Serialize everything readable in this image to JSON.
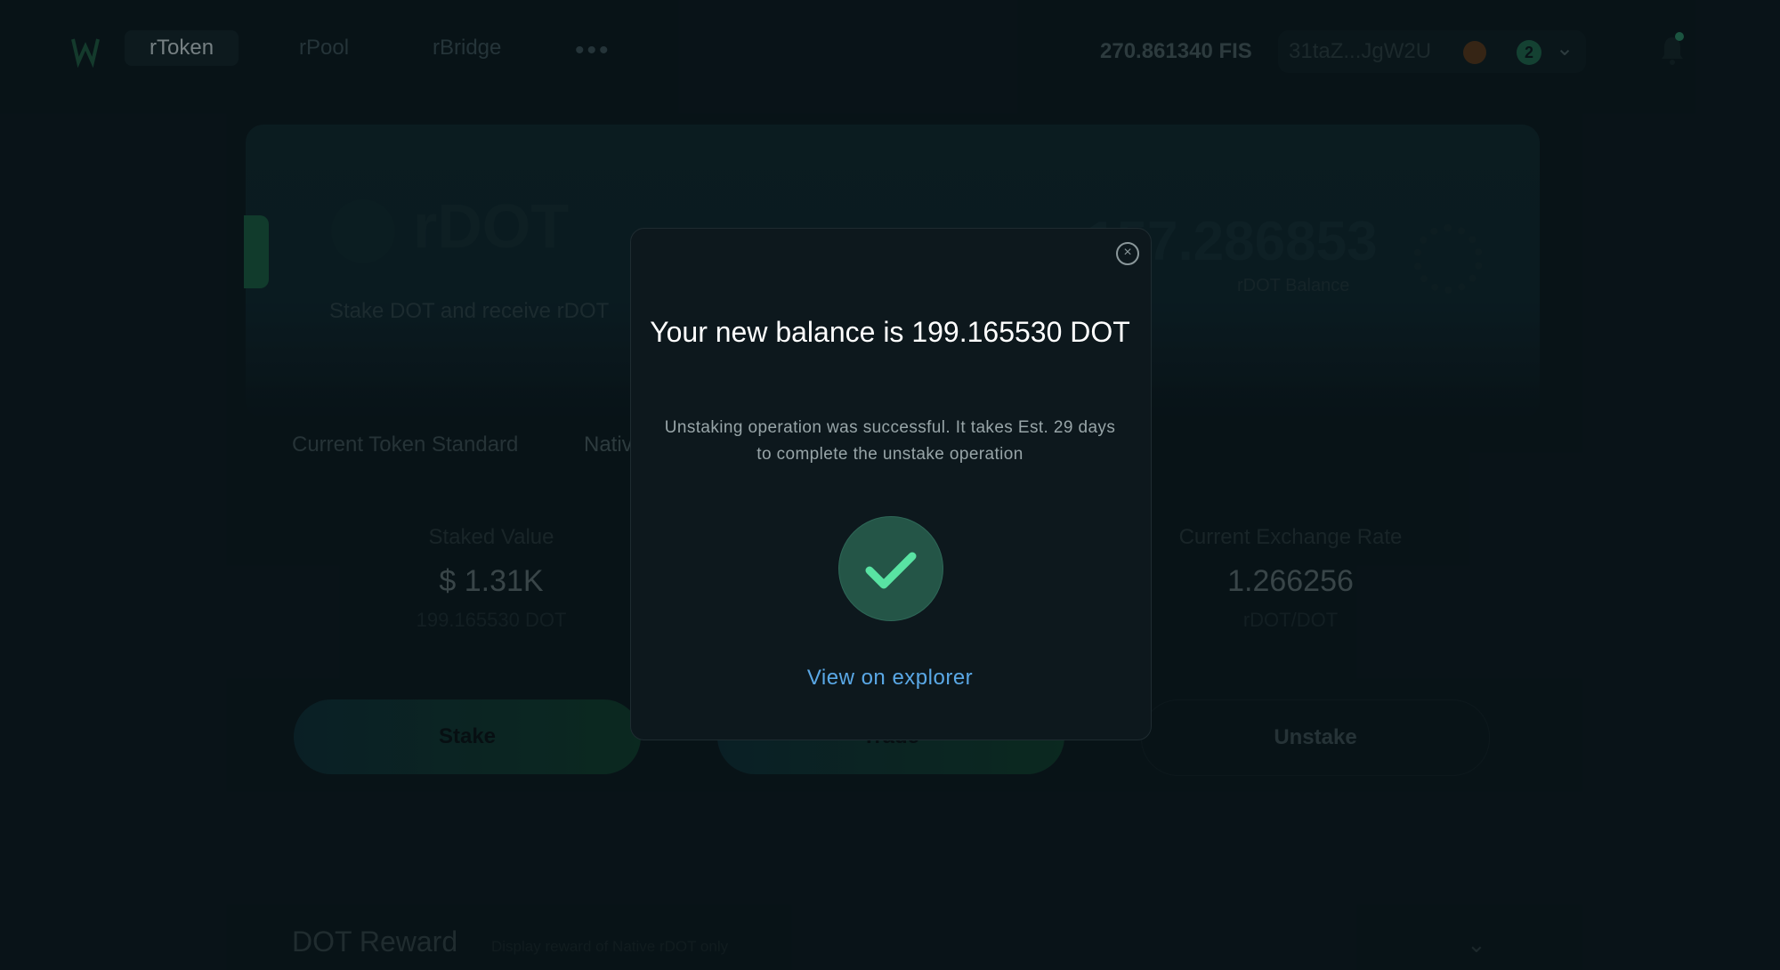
{
  "nav": {
    "items": [
      {
        "label": "rToken"
      },
      {
        "label": "rPool"
      },
      {
        "label": "rBridge"
      }
    ],
    "more_label": "•••",
    "fis_balance": "270.861340 FIS",
    "address": "31taZ...JgW2U",
    "notification_count": "2"
  },
  "hero": {
    "title": "rDOT",
    "subtitle": "Stake DOT and receive rDOT",
    "balance": "157.286853",
    "balance_label": "rDOT Balance"
  },
  "token_standard": {
    "label": "Current Token Standard",
    "value": "Nativ"
  },
  "stats": {
    "staked_label": "Staked Value",
    "staked_value": "$ 1.31K",
    "staked_sub": "199.165530 DOT",
    "rate_label": "Current Exchange Rate",
    "rate_value": "1.266256",
    "rate_sub": "rDOT/DOT"
  },
  "actions": {
    "stake": "Stake",
    "trade": "Trade",
    "unstake": "Unstake"
  },
  "reward": {
    "title": "DOT Reward",
    "subtitle": "Display reward of Native rDOT only"
  },
  "modal": {
    "title": "Your new balance is 199.165530 DOT",
    "message": "Unstaking operation was successful. It takes Est. 29 days to complete the unstake operation",
    "link": "View on explorer"
  }
}
